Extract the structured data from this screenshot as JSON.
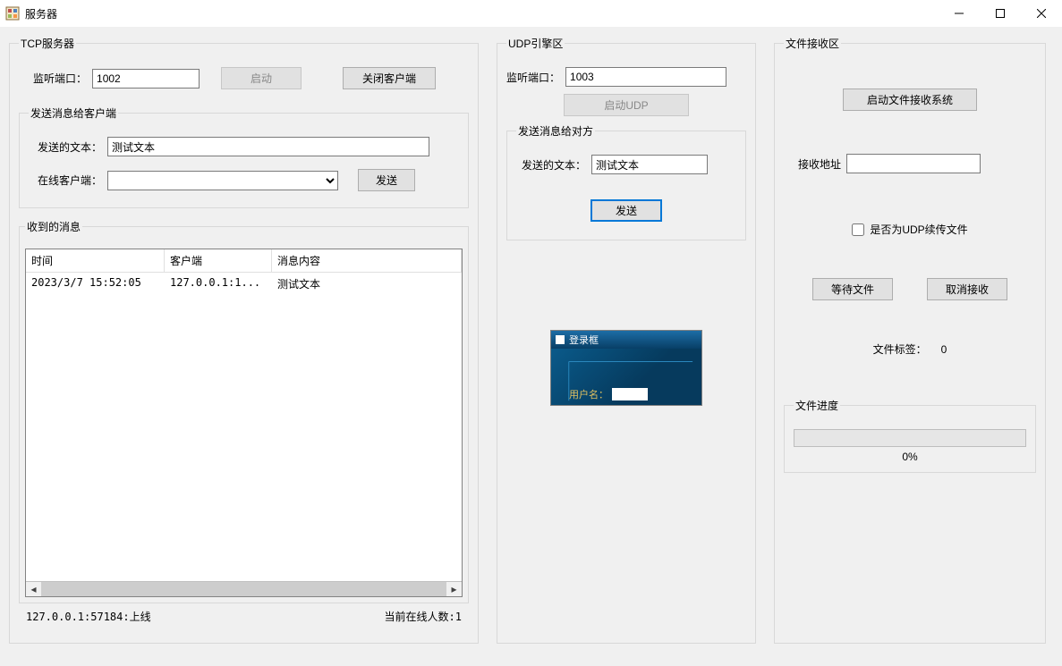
{
  "window": {
    "title": "服务器",
    "min_tooltip": "最小化",
    "max_tooltip": "最大化",
    "close_tooltip": "关闭"
  },
  "tcp": {
    "group_title": "TCP服务器",
    "listen_port_label": "监听端口：",
    "listen_port_value": "1002",
    "start_btn": "启动",
    "close_client_btn": "关闭客户端",
    "send_group_title": "发送消息给客户端",
    "send_text_label": "发送的文本：",
    "send_text_value": "测试文本",
    "online_clients_label": "在线客户端：",
    "online_clients_value": "",
    "send_btn": "发送",
    "recv_group_title": "收到的消息",
    "columns": {
      "time": "时间",
      "client": "客户端",
      "content": "消息内容"
    },
    "rows": [
      {
        "time": "2023/3/7 15:52:05",
        "client": "127.0.0.1:1...",
        "content": "测试文本"
      }
    ],
    "status_left": "127.0.0.1:57184:上线",
    "status_right": "当前在线人数:1"
  },
  "udp": {
    "group_title": "UDP引擎区",
    "listen_port_label": "监听端口：",
    "listen_port_value": "1003",
    "start_btn": "启动UDP",
    "send_group_title": "发送消息给对方",
    "send_text_label": "发送的文本：",
    "send_text_value": "测试文本",
    "send_btn": "发送",
    "preview_title": "登录框",
    "preview_user_label": "用户名："
  },
  "file": {
    "group_title": "文件接收区",
    "start_btn": "启动文件接收系统",
    "recv_addr_label": "接收地址",
    "recv_addr_value": "",
    "resume_checkbox_label": "是否为UDP续传文件",
    "wait_btn": "等待文件",
    "cancel_btn": "取消接收",
    "file_tag_label": "文件标签：",
    "file_tag_value": "0",
    "progress_group_title": "文件进度",
    "progress_value": 0,
    "progress_text": "0%"
  }
}
